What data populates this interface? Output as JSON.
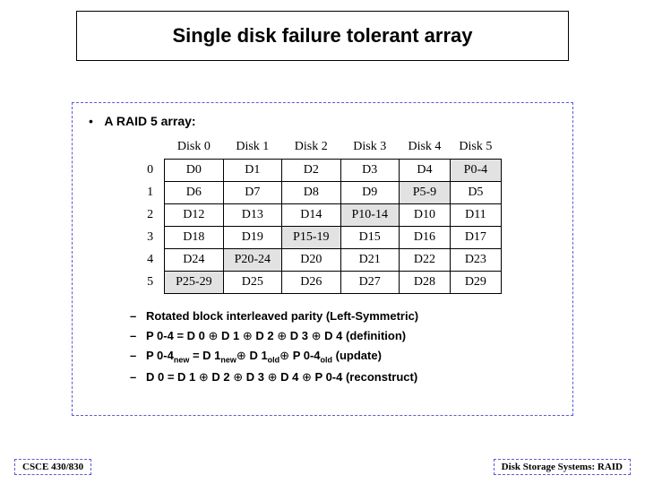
{
  "title": "Single disk failure tolerant array",
  "heading": "A RAID 5 array:",
  "table": {
    "col_headers": [
      "Disk 0",
      "Disk 1",
      "Disk 2",
      "Disk 3",
      "Disk 4",
      "Disk 5"
    ],
    "row_headers": [
      "0",
      "1",
      "2",
      "3",
      "4",
      "5"
    ],
    "rows": [
      [
        {
          "v": "D0"
        },
        {
          "v": "D1"
        },
        {
          "v": "D2"
        },
        {
          "v": "D3"
        },
        {
          "v": "D4"
        },
        {
          "v": "P0-4",
          "hl": true
        }
      ],
      [
        {
          "v": "D6"
        },
        {
          "v": "D7"
        },
        {
          "v": "D8"
        },
        {
          "v": "D9"
        },
        {
          "v": "P5-9",
          "hl": true
        },
        {
          "v": "D5"
        }
      ],
      [
        {
          "v": "D12"
        },
        {
          "v": "D13"
        },
        {
          "v": "D14"
        },
        {
          "v": "P10-14",
          "hl": true
        },
        {
          "v": "D10"
        },
        {
          "v": "D11"
        }
      ],
      [
        {
          "v": "D18"
        },
        {
          "v": "D19"
        },
        {
          "v": "P15-19",
          "hl": true
        },
        {
          "v": "D15"
        },
        {
          "v": "D16"
        },
        {
          "v": "D17"
        }
      ],
      [
        {
          "v": "D24"
        },
        {
          "v": "P20-24",
          "hl": true
        },
        {
          "v": "D20"
        },
        {
          "v": "D21"
        },
        {
          "v": "D22"
        },
        {
          "v": "D23"
        }
      ],
      [
        {
          "v": "P25-29",
          "hl": true
        },
        {
          "v": "D25"
        },
        {
          "v": "D26"
        },
        {
          "v": "D27"
        },
        {
          "v": "D28"
        },
        {
          "v": "D29"
        }
      ]
    ]
  },
  "bullets": {
    "b1": "Rotated block interleaved parity (Left-Symmetric)",
    "b2_pre": "P 0-4 = D 0 ",
    "b2_d1": " D 1 ",
    "b2_d2": " D 2 ",
    "b2_d3": " D 3 ",
    "b2_d4": " D 4  (definition)",
    "b3_pre": "P 0-4",
    "b3_sub1": "new",
    "b3_mid1": " =  D 1",
    "b3_sub2": "new",
    "b3_mid2": " D 1",
    "b3_sub3": "old",
    "b3_mid3": " P 0-4",
    "b3_sub4": "old",
    "b3_end": "  (update)",
    "b4_pre": "D 0 = D 1 ",
    "b4_d2": " D 2 ",
    "b4_d3": " D 3 ",
    "b4_d4": " D 4 ",
    "b4_p": " P 0-4  (reconstruct)"
  },
  "oplus": "⊕",
  "footer_left": "CSCE 430/830",
  "footer_right": "Disk Storage Systems: RAID"
}
